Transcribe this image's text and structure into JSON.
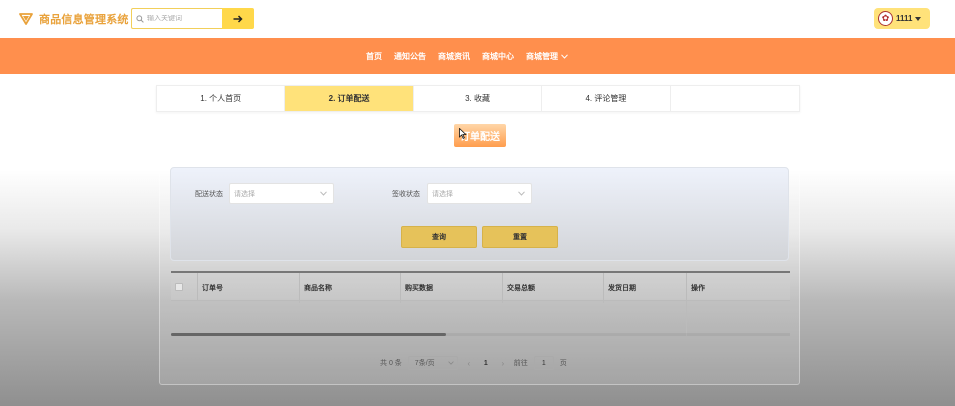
{
  "app": {
    "title": "商品信息管理系统",
    "accent_color": "#ff8f4d",
    "highlight_color": "#ffe27a"
  },
  "search": {
    "placeholder": "输入关键词",
    "button_icon": "arrow-right-icon"
  },
  "user": {
    "name": "1111",
    "avatar_icon": "avatar-icon"
  },
  "nav": {
    "items": [
      {
        "label": "首页"
      },
      {
        "label": "通知公告"
      },
      {
        "label": "商城资讯"
      },
      {
        "label": "商城中心"
      },
      {
        "label": "商城管理"
      }
    ]
  },
  "steps": [
    {
      "label": "1. 个人首页"
    },
    {
      "label": "2. 订单配送"
    },
    {
      "label": "3. 收藏"
    },
    {
      "label": "4. 评论管理"
    },
    {
      "label": ""
    }
  ],
  "page": {
    "title": "订单配送"
  },
  "filter": {
    "delivery_status_label": "配送状态",
    "delivery_status_value": "请选择",
    "sign_status_label": "签收状态",
    "sign_status_value": "请选择",
    "query_label": "查询",
    "reset_label": "重置"
  },
  "table": {
    "columns": [
      "订单号",
      "商品名称",
      "购买数据",
      "交易总额",
      "发货日期",
      "操作"
    ]
  },
  "pager": {
    "total": "共 0 条",
    "page_size": "7条/页",
    "current_page": "1",
    "goto_label": "前往",
    "goto_value": "1",
    "page_suffix": "页"
  }
}
